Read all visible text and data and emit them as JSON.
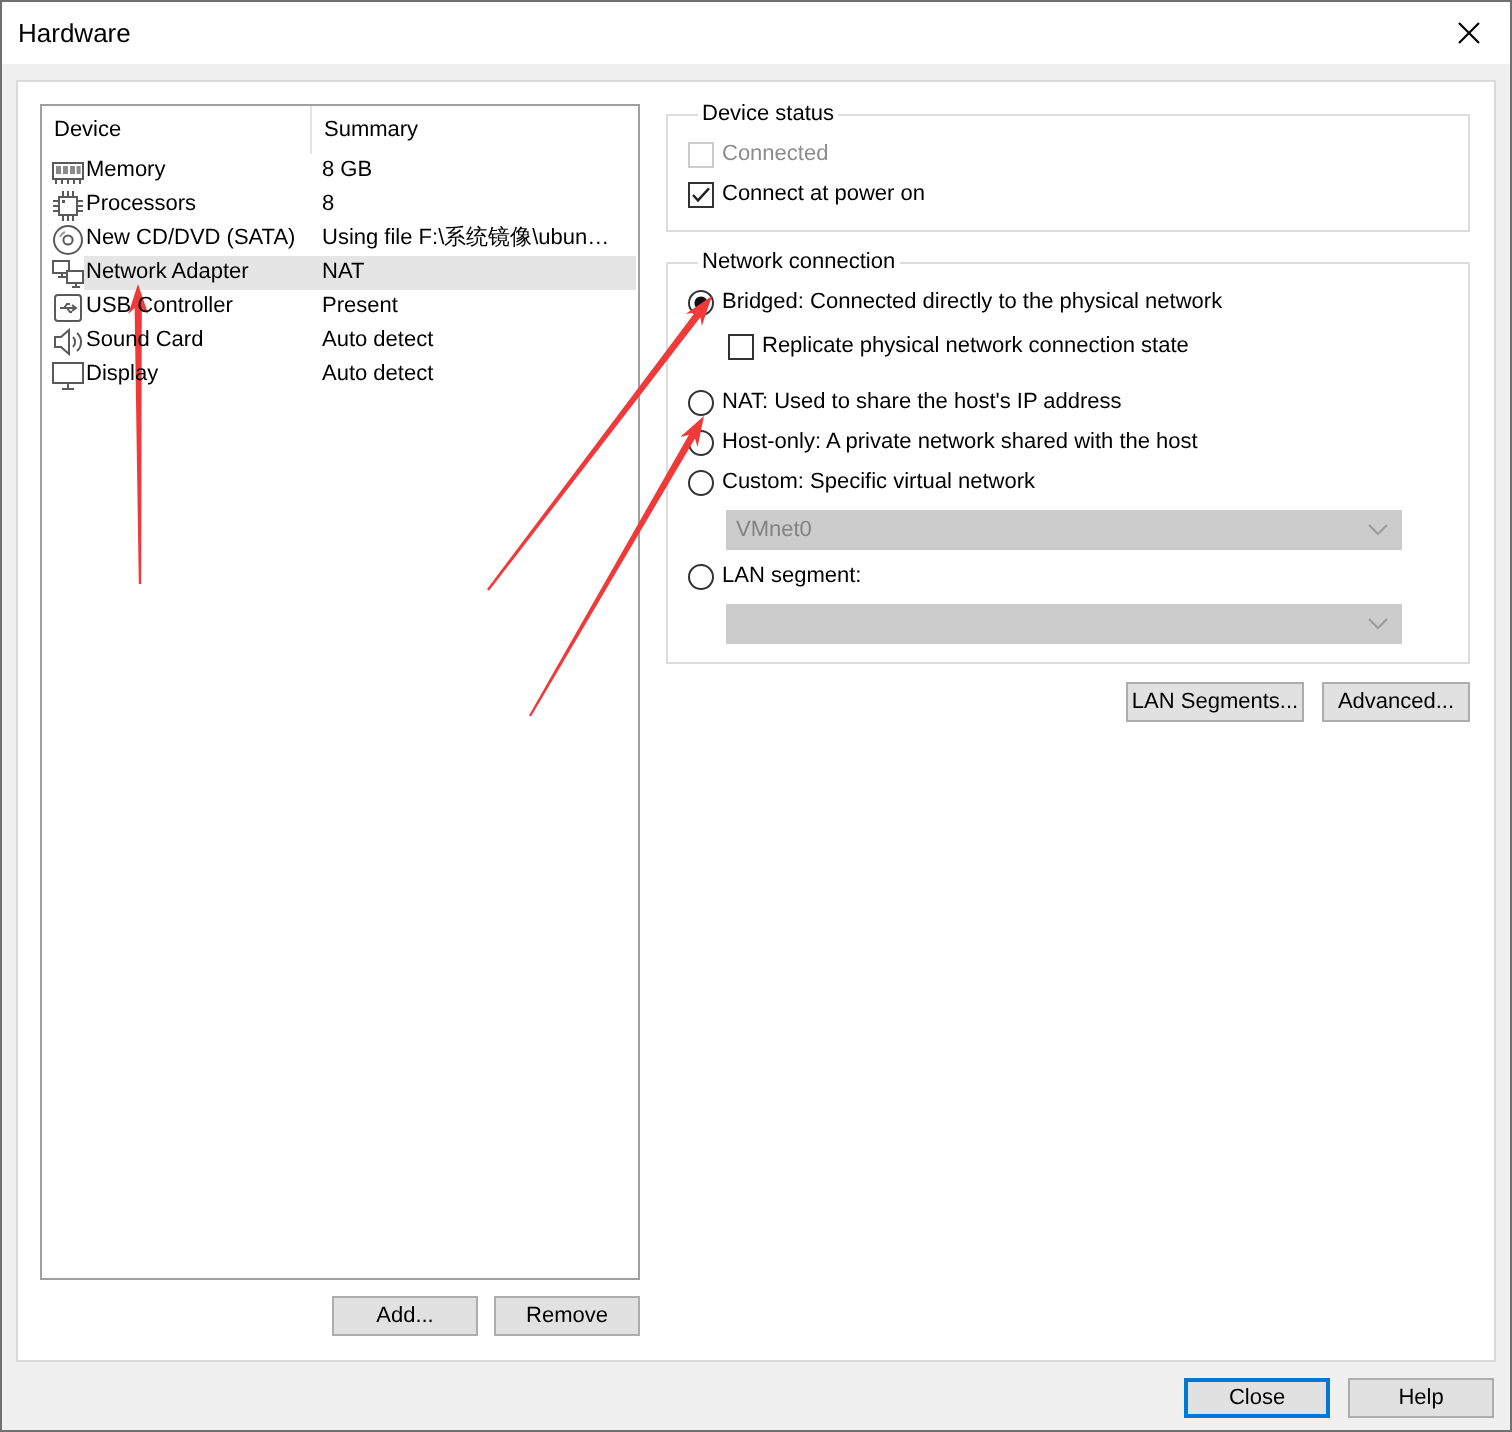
{
  "window": {
    "title": "Hardware"
  },
  "devices": {
    "columns": [
      "Device",
      "Summary"
    ],
    "rows": [
      {
        "kind": "memory",
        "name": "Memory",
        "summary": "8 GB",
        "selected": false
      },
      {
        "kind": "processor",
        "name": "Processors",
        "summary": "8",
        "selected": false
      },
      {
        "kind": "cd",
        "name": "New CD/DVD (SATA)",
        "summary": "Using file F:\\系统镜像\\ubun…",
        "selected": false
      },
      {
        "kind": "network",
        "name": "Network Adapter",
        "summary": "NAT",
        "selected": true
      },
      {
        "kind": "usb",
        "name": "USB Controller",
        "summary": "Present",
        "selected": false
      },
      {
        "kind": "sound",
        "name": "Sound Card",
        "summary": "Auto detect",
        "selected": false
      },
      {
        "kind": "display",
        "name": "Display",
        "summary": "Auto detect",
        "selected": false
      }
    ]
  },
  "device_buttons": [
    "Add...",
    "Remove"
  ],
  "device_status": {
    "title": "Device status",
    "options": [
      {
        "label": "Connected",
        "checked": false,
        "disabled": true
      },
      {
        "label": "Connect at power on",
        "checked": true,
        "disabled": false
      }
    ]
  },
  "network_connection": {
    "title": "Network connection",
    "options": [
      {
        "kind": "radio",
        "label": "Bridged: Connected directly to the physical network",
        "selected": true,
        "children": [
          {
            "kind": "checkbox",
            "label": "Replicate physical network connection state",
            "checked": false,
            "disabled": false
          }
        ]
      },
      {
        "kind": "radio",
        "label": "NAT: Used to share the host's IP address",
        "selected": false
      },
      {
        "kind": "radio",
        "label": "Host-only: A private network shared with the host",
        "selected": false
      },
      {
        "kind": "radio",
        "label": "Custom: Specific virtual network",
        "selected": false,
        "children": [
          {
            "kind": "dropdown",
            "value": "VMnet0",
            "disabled": true
          }
        ]
      },
      {
        "kind": "radio",
        "label": "LAN segment:",
        "selected": false,
        "children": [
          {
            "kind": "dropdown",
            "disabled": true
          }
        ]
      }
    ]
  },
  "network_buttons": [
    "LAN Segments...",
    "Advanced..."
  ],
  "footer_buttons": [
    {
      "label": "Close",
      "default": true
    },
    {
      "label": "Help",
      "default": false
    }
  ]
}
